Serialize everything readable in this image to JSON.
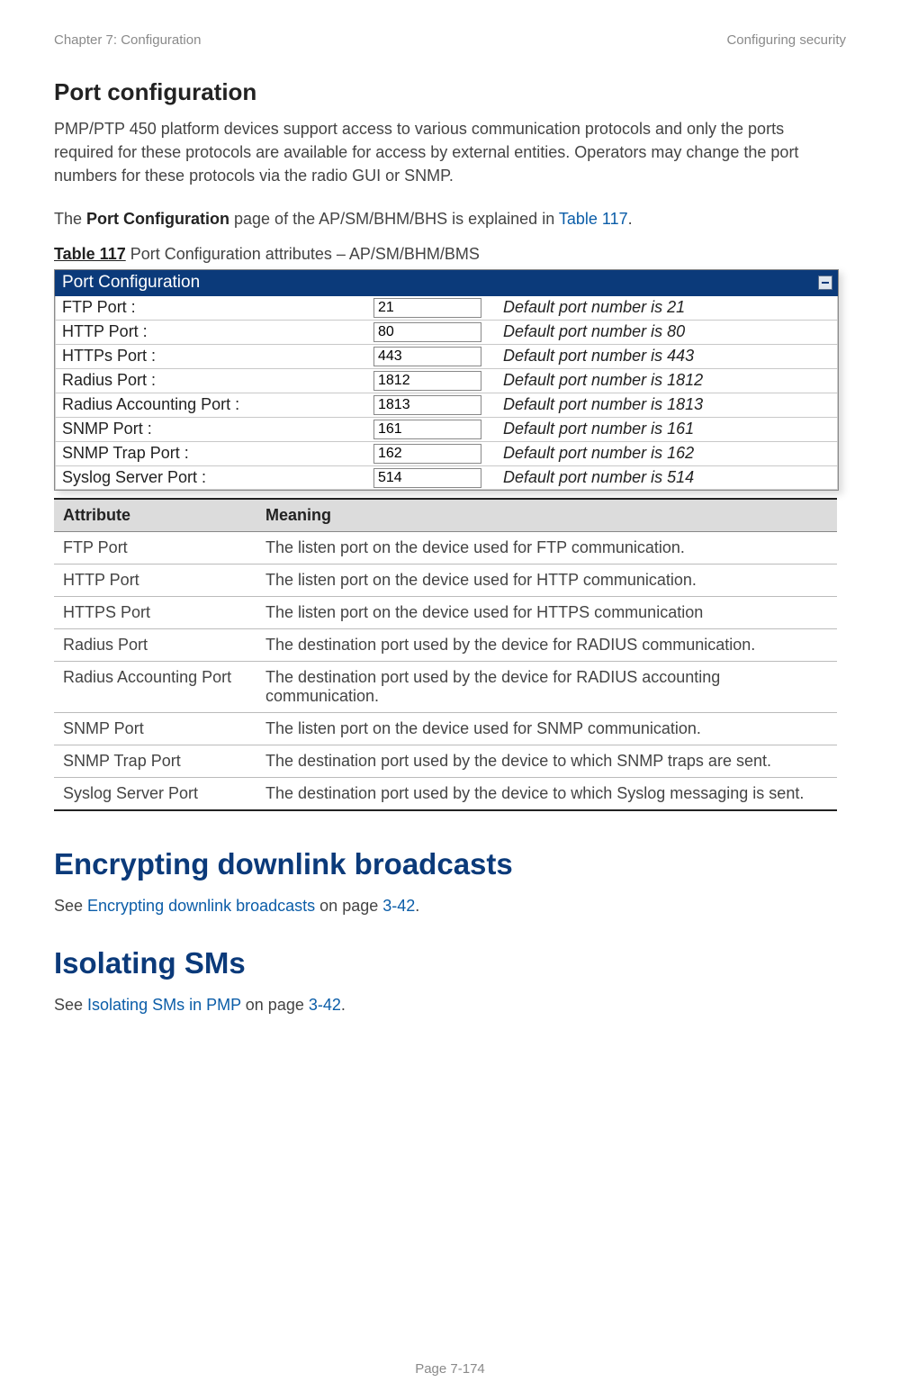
{
  "header": {
    "left": "Chapter 7:  Configuration",
    "right": "Configuring security"
  },
  "section1": {
    "title": "Port configuration",
    "p1": "PMP/PTP 450 platform devices support access to various communication protocols and only the ports required for these protocols are available for access by external entities. Operators may change the port numbers for these protocols via the radio GUI or SNMP.",
    "p2_pre": "The ",
    "p2_bold": "Port Configuration",
    "p2_mid": " page of the AP/SM/BHM/BHS is explained in ",
    "p2_link": "Table 117",
    "p2_post": ".",
    "tbl_label_bold": "Table 117",
    "tbl_label_rest": " Port Configuration attributes – AP/SM/BHM/BMS"
  },
  "portconfig": {
    "title": "Port Configuration",
    "rows": [
      {
        "label": "FTP Port :",
        "value": "21",
        "hint": "Default port number is 21"
      },
      {
        "label": "HTTP Port :",
        "value": "80",
        "hint": "Default port number is 80"
      },
      {
        "label": "HTTPs Port :",
        "value": "443",
        "hint": "Default port number is 443"
      },
      {
        "label": "Radius Port :",
        "value": "1812",
        "hint": "Default port number is 1812"
      },
      {
        "label": "Radius Accounting Port :",
        "value": "1813",
        "hint": "Default port number is 1813"
      },
      {
        "label": "SNMP Port :",
        "value": "161",
        "hint": "Default port number is 161"
      },
      {
        "label": "SNMP Trap Port :",
        "value": "162",
        "hint": "Default port number is 162"
      },
      {
        "label": "Syslog Server Port :",
        "value": "514",
        "hint": "Default port number is 514"
      }
    ]
  },
  "attrtable": {
    "head": {
      "c1": "Attribute",
      "c2": "Meaning"
    },
    "rows": [
      {
        "attr": "FTP Port",
        "meaning": "The listen port on the device used for FTP communication."
      },
      {
        "attr": "HTTP Port",
        "meaning": "The listen port on the device used for HTTP communication."
      },
      {
        "attr": "HTTPS Port",
        "meaning": "The listen port on the device used for HTTPS communication"
      },
      {
        "attr": "Radius Port",
        "meaning": "The destination port used by the device for RADIUS communication."
      },
      {
        "attr": "Radius Accounting Port",
        "meaning": "The destination port used by the device for RADIUS accounting communication."
      },
      {
        "attr": "SNMP Port",
        "meaning": "The listen port on the device used for SNMP communication."
      },
      {
        "attr": "SNMP Trap Port",
        "meaning": "The destination port used by the device to which SNMP traps are sent."
      },
      {
        "attr": "Syslog Server Port",
        "meaning": "The destination port used by the device to which Syslog messaging is sent."
      }
    ]
  },
  "section2": {
    "title": "Encrypting downlink broadcasts",
    "p_pre": "See ",
    "p_link": "Encrypting downlink broadcasts",
    "p_mid": " on page ",
    "p_page": "3-42",
    "p_post": "."
  },
  "section3": {
    "title": "Isolating SMs",
    "p_pre": "See ",
    "p_link": "Isolating SMs in PMP",
    "p_mid": " on page ",
    "p_page": "3-42",
    "p_post": "."
  },
  "footer": {
    "text": "Page 7-174"
  }
}
